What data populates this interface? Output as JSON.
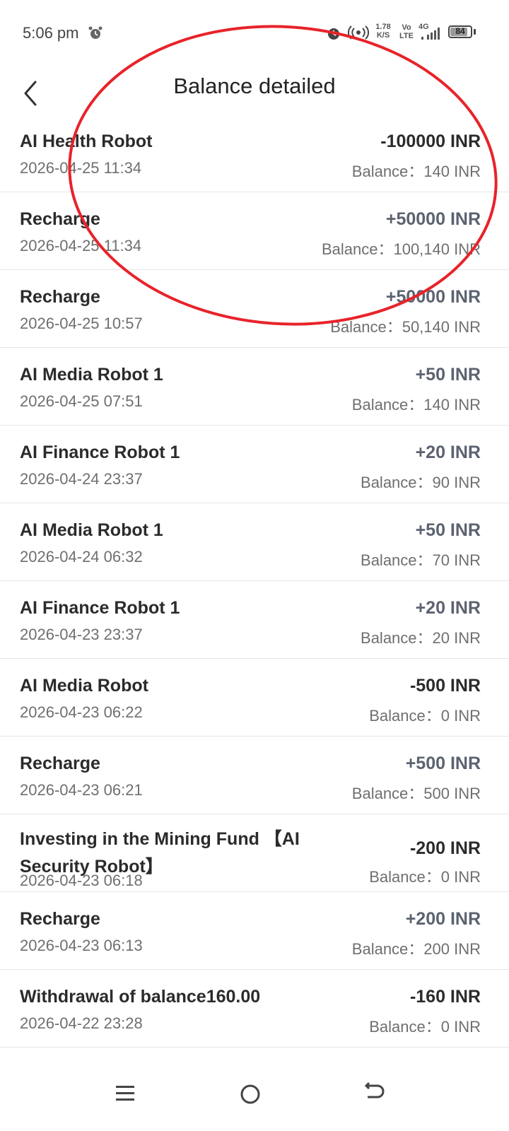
{
  "status_bar": {
    "time": "5:06 pm",
    "net_speed_value": "1.78",
    "net_speed_unit": "K/S",
    "volte_top": "Vo",
    "volte_bottom": "LTE",
    "network": "4G",
    "battery": "84",
    "battery_level": 0.84
  },
  "header": {
    "title": "Balance detailed"
  },
  "transactions": [
    {
      "title": "AI Health Robot",
      "date": "2026-04-25 11:34",
      "amount": "-100000 INR",
      "type": "neg",
      "balance": "Balance：140 INR"
    },
    {
      "title": "Recharge",
      "date": "2026-04-25 11:34",
      "amount": "+50000 INR",
      "type": "pos",
      "balance": "Balance：100,140 INR"
    },
    {
      "title": "Recharge",
      "date": "2026-04-25 10:57",
      "amount": "+50000 INR",
      "type": "pos",
      "balance": "Balance：50,140 INR"
    },
    {
      "title": "AI Media Robot 1",
      "date": "2026-04-25 07:51",
      "amount": "+50 INR",
      "type": "pos",
      "balance": "Balance：140 INR"
    },
    {
      "title": "AI Finance Robot 1",
      "date": "2026-04-24 23:37",
      "amount": "+20 INR",
      "type": "pos",
      "balance": "Balance：90 INR"
    },
    {
      "title": "AI Media Robot 1",
      "date": "2026-04-24 06:32",
      "amount": "+50 INR",
      "type": "pos",
      "balance": "Balance：70 INR"
    },
    {
      "title": "AI Finance Robot 1",
      "date": "2026-04-23 23:37",
      "amount": "+20 INR",
      "type": "pos",
      "balance": "Balance：20 INR"
    },
    {
      "title": "AI Media Robot",
      "date": "2026-04-23 06:22",
      "amount": "-500 INR",
      "type": "neg",
      "balance": "Balance：0 INR"
    },
    {
      "title": "Recharge",
      "date": "2026-04-23 06:21",
      "amount": "+500 INR",
      "type": "pos",
      "balance": "Balance：500 INR"
    },
    {
      "title": "Investing in the Mining Fund 【AI Security Robot】",
      "date": "2026-04-23 06:18",
      "amount": "-200 INR",
      "type": "neg",
      "balance": "Balance：0 INR"
    },
    {
      "title": "Recharge",
      "date": "2026-04-23 06:13",
      "amount": "+200 INR",
      "type": "pos",
      "balance": "Balance：200 INR"
    },
    {
      "title": "Withdrawal of balance160.00",
      "date": "2026-04-22 23:28",
      "amount": "-160 INR",
      "type": "neg",
      "balance": "Balance：0 INR"
    }
  ],
  "icons": {
    "back": "chevron-left-icon",
    "alarm": "alarm-icon",
    "hotspot": "hotspot-icon",
    "signal": "signal-icon",
    "battery": "battery-icon",
    "nav_menu": "menu-icon",
    "nav_home": "home-icon",
    "nav_back": "back-icon"
  },
  "colors": {
    "annotation": "#e8232a",
    "positive_amount": "#5b6270",
    "negative_amount": "#2b2b2b"
  }
}
